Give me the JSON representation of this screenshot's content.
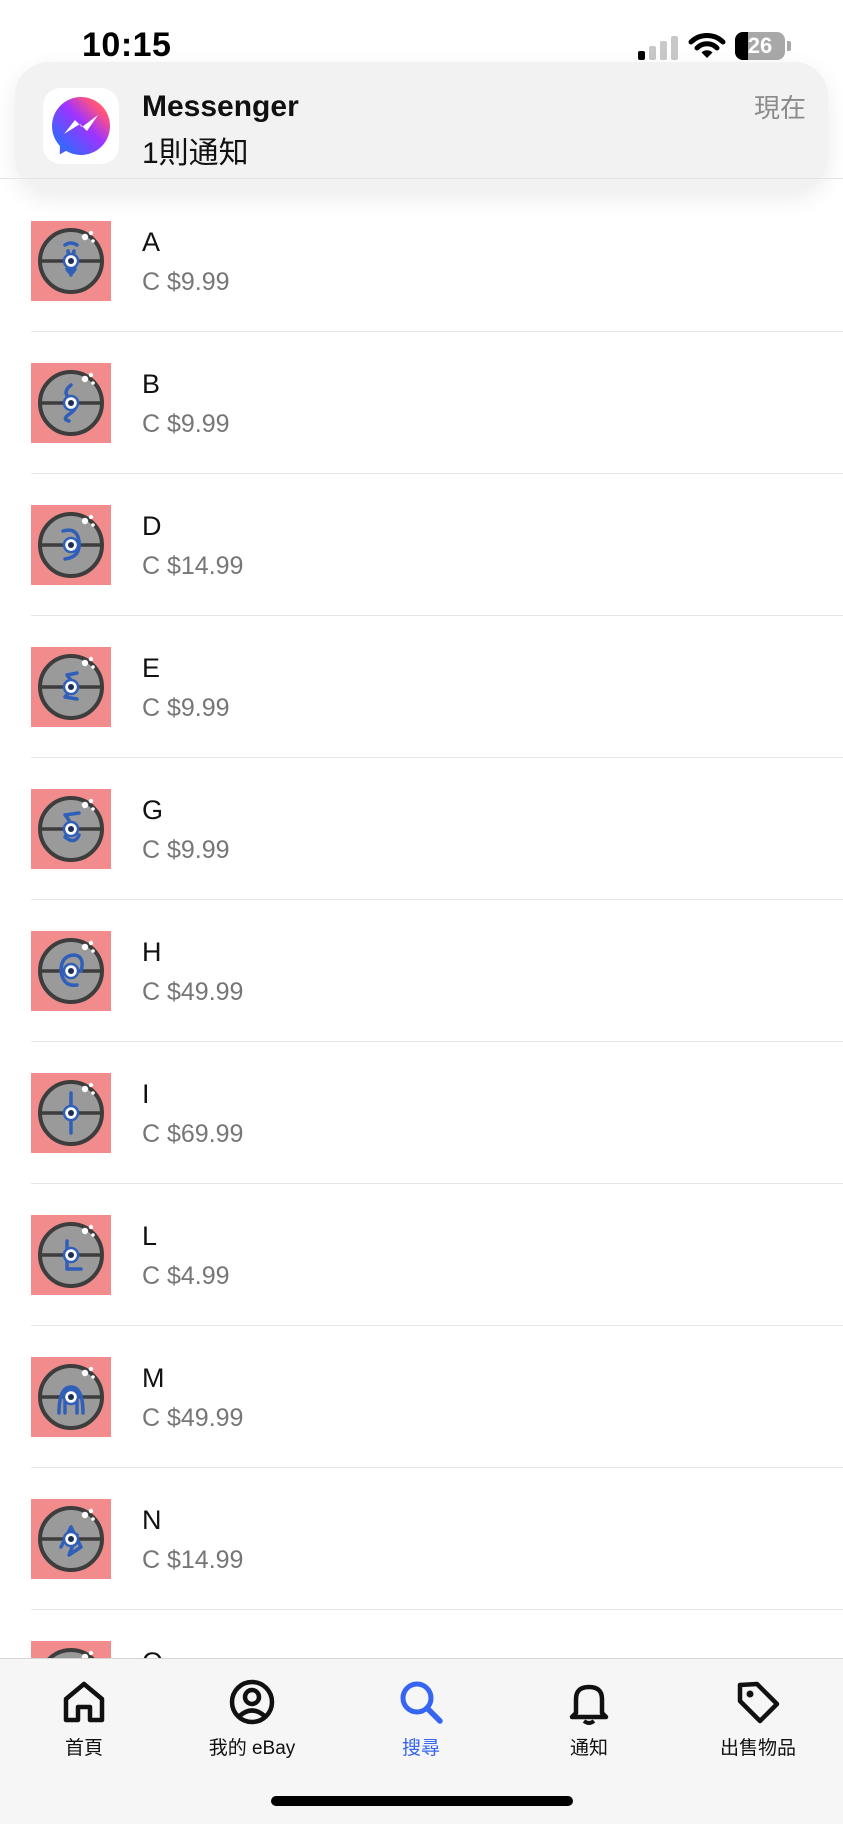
{
  "status_bar": {
    "time": "10:15",
    "battery_level": "26",
    "signal_icon": "cellular-signal-icon",
    "wifi_icon": "wifi-icon"
  },
  "notification": {
    "app_name": "Messenger",
    "message": "1則通知",
    "time": "現在",
    "icon": "messenger-app-icon"
  },
  "listings": [
    {
      "title": "A",
      "price": "C $9.99"
    },
    {
      "title": "B",
      "price": "C $9.99"
    },
    {
      "title": "D",
      "price": "C $14.99"
    },
    {
      "title": "E",
      "price": "C $9.99"
    },
    {
      "title": "G",
      "price": "C $9.99"
    },
    {
      "title": "H",
      "price": "C $49.99"
    },
    {
      "title": "I",
      "price": "C $69.99"
    },
    {
      "title": "L",
      "price": "C $4.99"
    },
    {
      "title": "M",
      "price": "C $49.99"
    },
    {
      "title": "N",
      "price": "C $14.99"
    },
    {
      "title": "O",
      "price": ""
    }
  ],
  "tabbar": {
    "home": "首頁",
    "my_ebay": "我的 eBay",
    "search": "搜尋",
    "notifications": "通知",
    "selling": "出售物品"
  },
  "colors": {
    "accent": "#3665f3",
    "thumbnail_background": "#f28b8b",
    "price_text": "#767676"
  }
}
